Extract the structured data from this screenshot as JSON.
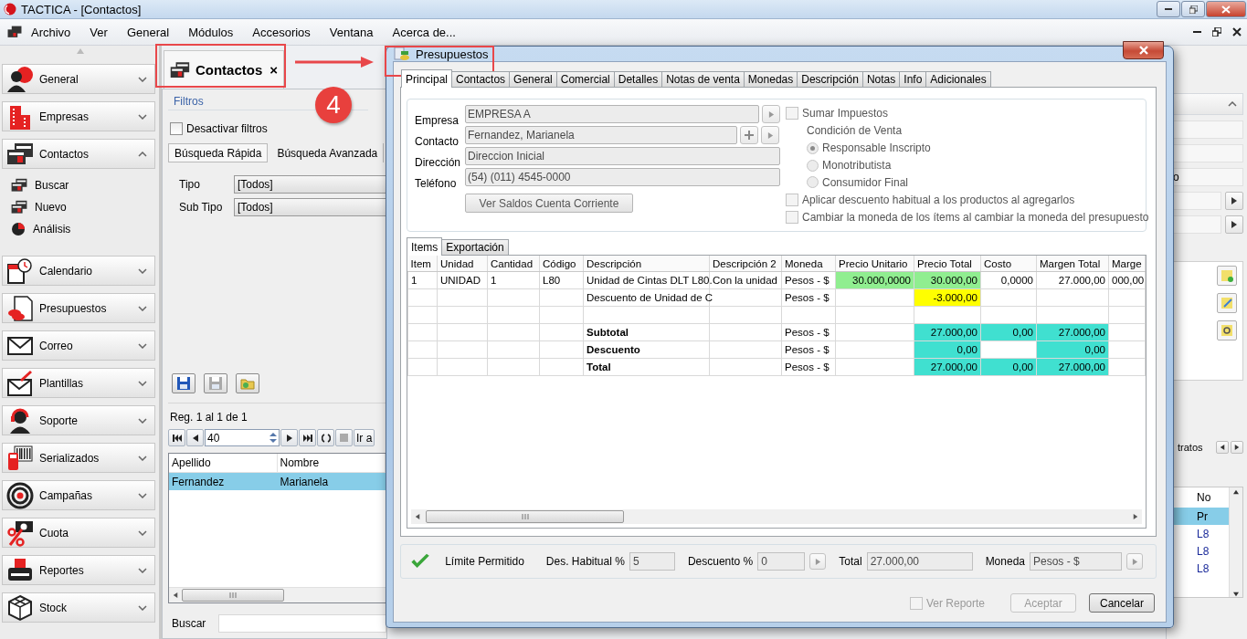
{
  "window": {
    "title": "TACTICA - [Contactos]"
  },
  "menu": {
    "items": [
      "Archivo",
      "Ver",
      "General",
      "Módulos",
      "Accesorios",
      "Ventana",
      "Acerca de..."
    ]
  },
  "sidebar": {
    "groups": [
      {
        "label": "General",
        "expanded": false
      },
      {
        "label": "Empresas",
        "expanded": false
      },
      {
        "label": "Contactos",
        "expanded": true,
        "items": [
          "Buscar",
          "Nuevo",
          "Análisis"
        ]
      },
      {
        "label": "Calendario",
        "expanded": false
      },
      {
        "label": "Presupuestos",
        "expanded": false
      },
      {
        "label": "Correo",
        "expanded": false
      },
      {
        "label": "Plantillas",
        "expanded": false
      },
      {
        "label": "Soporte",
        "expanded": false
      },
      {
        "label": "Serializados",
        "expanded": false
      },
      {
        "label": "Campañas",
        "expanded": false
      },
      {
        "label": "Cuota",
        "expanded": false
      },
      {
        "label": "Reportes",
        "expanded": false
      },
      {
        "label": "Stock",
        "expanded": false
      }
    ]
  },
  "document_tab": {
    "label": "Contactos",
    "close": "×"
  },
  "callout": {
    "number": "4"
  },
  "contacts": {
    "filters_title": "Filtros",
    "disable_filters": {
      "label": "Desactivar filtros",
      "checked": false
    },
    "search_tabs": [
      {
        "label": "Búsqueda Rápida",
        "selected": true
      },
      {
        "label": "Búsqueda Avanzada",
        "selected": false
      }
    ],
    "fields": [
      {
        "label": "Tipo",
        "value": "[Todos]"
      },
      {
        "label": "Sub Tipo",
        "value": "[Todos]"
      }
    ],
    "summary": "Reg. 1 al 1 de 1",
    "page_size": "40",
    "goto": "Ir a",
    "columns": [
      "Apellido",
      "Nombre"
    ],
    "rows": [
      {
        "cells": [
          "Fernandez",
          "Marianela"
        ],
        "selected": true
      }
    ],
    "search_label": "Buscar"
  },
  "right_panel": {
    "field_text": "o",
    "tab_text": "tratos",
    "column": "No",
    "rows": [
      {
        "text": "Pr",
        "selected": true
      },
      {
        "text": "L8",
        "selected": false
      },
      {
        "text": "L8",
        "selected": false
      },
      {
        "text": "L8",
        "selected": false
      }
    ]
  },
  "dialog": {
    "title": "Presupuestos",
    "tabs": [
      {
        "label": "Principal",
        "selected": true
      },
      {
        "label": "Contactos",
        "selected": false
      },
      {
        "label": "General",
        "selected": false
      },
      {
        "label": "Comercial",
        "selected": false
      },
      {
        "label": "Detalles",
        "selected": false
      },
      {
        "label": "Notas de venta",
        "selected": false
      },
      {
        "label": "Monedas",
        "selected": false
      },
      {
        "label": "Descripción",
        "selected": false
      },
      {
        "label": "Notas",
        "selected": false
      },
      {
        "label": "Info",
        "selected": false
      },
      {
        "label": "Adicionales",
        "selected": false
      }
    ],
    "form": [
      {
        "label": "Empresa",
        "value": "EMPRESA A",
        "disabled": true,
        "kind": "link"
      },
      {
        "label": "Contacto",
        "value": "Fernandez, Marianela",
        "disabled": true,
        "kind": "add-link"
      },
      {
        "label": "Dirección",
        "value": "Direccion Inicial",
        "disabled": true,
        "kind": "plain"
      },
      {
        "label": "Teléfono",
        "value": "(54) (011) 4545-0000",
        "disabled": true,
        "kind": "plain"
      }
    ],
    "balance_button": "Ver Saldos Cuenta Corriente",
    "options": [
      {
        "kind": "checkbox",
        "label": "Sumar Impuestos",
        "checked": false
      },
      {
        "kind": "heading",
        "label": "Condición de Venta"
      },
      {
        "kind": "radio",
        "label": "Responsable Inscripto",
        "selected": true
      },
      {
        "kind": "radio",
        "label": "Monotributista",
        "selected": false
      },
      {
        "kind": "radio",
        "label": "Consumidor Final",
        "selected": false
      },
      {
        "kind": "checkbox",
        "label": "Aplicar descuento habitual a los productos al agregarlos",
        "checked": false
      },
      {
        "kind": "checkbox",
        "label": "Cambiar la moneda de los ítems al cambiar la moneda del presupuesto",
        "checked": false
      }
    ],
    "inner_tabs": [
      {
        "label": "Items",
        "selected": true
      },
      {
        "label": "Exportación",
        "selected": false
      }
    ],
    "grid": {
      "columns": [
        "Item",
        "Unidad",
        "Cantidad",
        "Código",
        "Descripción",
        "Descripción 2",
        "Moneda",
        "Precio Unitario",
        "Precio Total",
        "Costo",
        "Margen Total",
        "Marge"
      ],
      "rows": [
        {
          "kind": "item",
          "cells": [
            {
              "text": "1"
            },
            {
              "text": "UNIDAD"
            },
            {
              "text": "1"
            },
            {
              "text": "L80"
            },
            {
              "text": "Unidad de Cintas DLT L80."
            },
            {
              "text": "Con la unidad"
            },
            {
              "text": "Pesos - $"
            },
            {
              "text": "30.000,0000",
              "color": "#90ee90"
            },
            {
              "text": "30.000,00",
              "color": "#90ee90"
            },
            {
              "text": "0,0000"
            },
            {
              "text": "27.000,00"
            },
            {
              "text": "000,00"
            }
          ]
        },
        {
          "kind": "item",
          "cells": [
            {},
            {},
            {},
            {},
            {
              "text": "Descuento de Unidad de C"
            },
            {},
            {
              "text": "Pesos - $"
            },
            {},
            {
              "text": "-3.000,00",
              "color": "#ffff00"
            },
            {},
            {},
            {}
          ]
        },
        {
          "kind": "item",
          "cells": [
            {},
            {},
            {},
            {},
            {},
            {},
            {},
            {},
            {},
            {},
            {},
            {}
          ]
        },
        {
          "kind": "total",
          "cells": [
            {},
            {},
            {},
            {},
            {
              "text": "Subtotal"
            },
            {},
            {
              "text": "Pesos - $"
            },
            {},
            {
              "text": "27.000,00",
              "color": "#40e0d0"
            },
            {
              "text": "0,00",
              "color": "#40e0d0"
            },
            {
              "text": "27.000,00",
              "color": "#40e0d0"
            },
            {}
          ]
        },
        {
          "kind": "total",
          "cells": [
            {},
            {},
            {},
            {},
            {
              "text": "Descuento"
            },
            {},
            {
              "text": "Pesos - $"
            },
            {},
            {
              "text": "0,00",
              "color": "#40e0d0"
            },
            {},
            {
              "text": "0,00",
              "color": "#40e0d0"
            },
            {}
          ]
        },
        {
          "kind": "total",
          "cells": [
            {},
            {},
            {},
            {},
            {
              "text": "Total"
            },
            {},
            {
              "text": "Pesos - $"
            },
            {},
            {
              "text": "27.000,00",
              "color": "#40e0d0"
            },
            {
              "text": "0,00",
              "color": "#40e0d0"
            },
            {
              "text": "27.000,00",
              "color": "#40e0d0"
            },
            {}
          ]
        }
      ]
    },
    "footer": {
      "status": "Límite Permitido",
      "fields": [
        {
          "label": "Des. Habitual %",
          "value": "5",
          "kind": "plain"
        },
        {
          "label": "Descuento %",
          "value": "0",
          "kind": "link"
        },
        {
          "label": "Total",
          "value": "27.000,00",
          "kind": "plain"
        },
        {
          "label": "Moneda",
          "value": "Pesos - $",
          "kind": "link"
        }
      ]
    },
    "report": {
      "label": "Ver Reporte",
      "checked": false,
      "disabled": true
    },
    "buttons": [
      {
        "label": "Aceptar",
        "disabled": true
      },
      {
        "label": "Cancelar",
        "disabled": false
      }
    ]
  }
}
